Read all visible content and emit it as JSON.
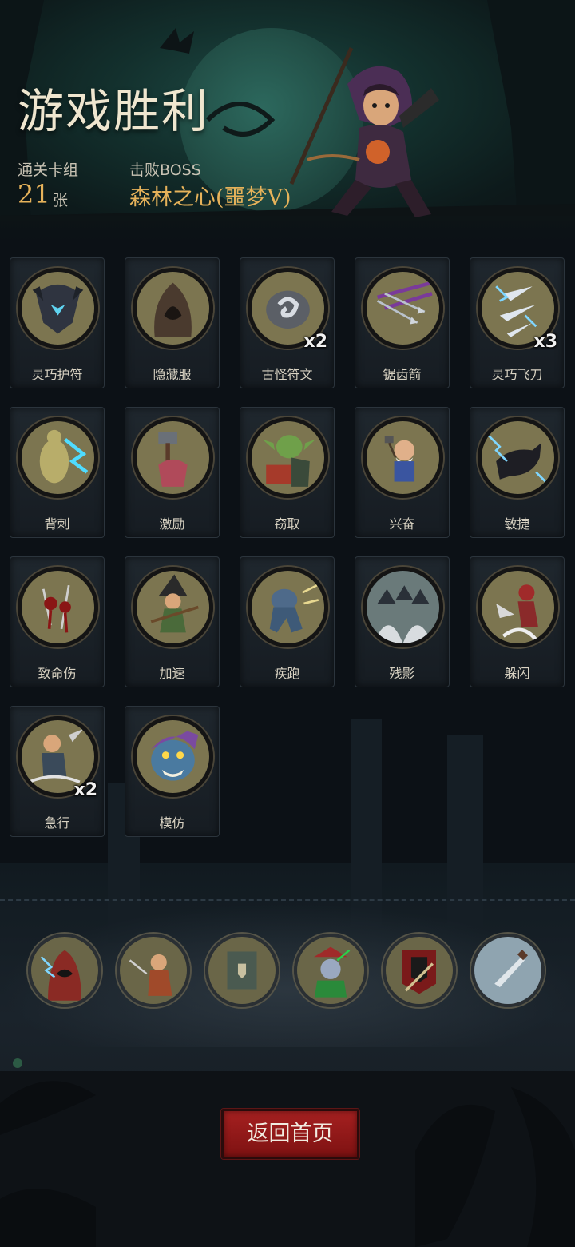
{
  "header": {
    "title": "游戏胜利",
    "deck_label": "通关卡组",
    "deck_count": "21",
    "deck_unit": "张",
    "boss_label": "击败BOSS",
    "boss_name": "森林之心(噩梦V)"
  },
  "cards": [
    {
      "name": "灵巧护符",
      "count": "",
      "icon": "amulet-icon"
    },
    {
      "name": "隐藏服",
      "count": "",
      "icon": "hood-icon"
    },
    {
      "name": "古怪符文",
      "count": "x2",
      "icon": "rune-icon"
    },
    {
      "name": "锯齿箭",
      "count": "",
      "icon": "arrows-icon"
    },
    {
      "name": "灵巧飞刀",
      "count": "x3",
      "icon": "daggers-icon"
    },
    {
      "name": "背刺",
      "count": "",
      "icon": "backstab-icon"
    },
    {
      "name": "激励",
      "count": "",
      "icon": "hammer-icon"
    },
    {
      "name": "窃取",
      "count": "",
      "icon": "goblin-icon"
    },
    {
      "name": "兴奋",
      "count": "",
      "icon": "dwarf-icon"
    },
    {
      "name": "敏捷",
      "count": "",
      "icon": "panther-icon"
    },
    {
      "name": "致命伤",
      "count": "",
      "icon": "wound-icon"
    },
    {
      "name": "加速",
      "count": "",
      "icon": "witch-icon"
    },
    {
      "name": "疾跑",
      "count": "",
      "icon": "runner-icon"
    },
    {
      "name": "残影",
      "count": "",
      "icon": "afterimage-icon"
    },
    {
      "name": "躲闪",
      "count": "",
      "icon": "dodge-icon"
    },
    {
      "name": "急行",
      "count": "x2",
      "icon": "dash-icon"
    },
    {
      "name": "模仿",
      "count": "",
      "icon": "mimic-icon"
    }
  ],
  "relics": [
    {
      "icon": "hooded-mage-icon"
    },
    {
      "icon": "rogue-icon"
    },
    {
      "icon": "book-icon"
    },
    {
      "icon": "jester-icon"
    },
    {
      "icon": "banner-icon"
    },
    {
      "icon": "knife-icon"
    }
  ],
  "buttons": {
    "home": "返回首页"
  },
  "colors": {
    "accent": "#e6b25a",
    "button": "#9a1a1a",
    "card_art": "#7c7550"
  }
}
